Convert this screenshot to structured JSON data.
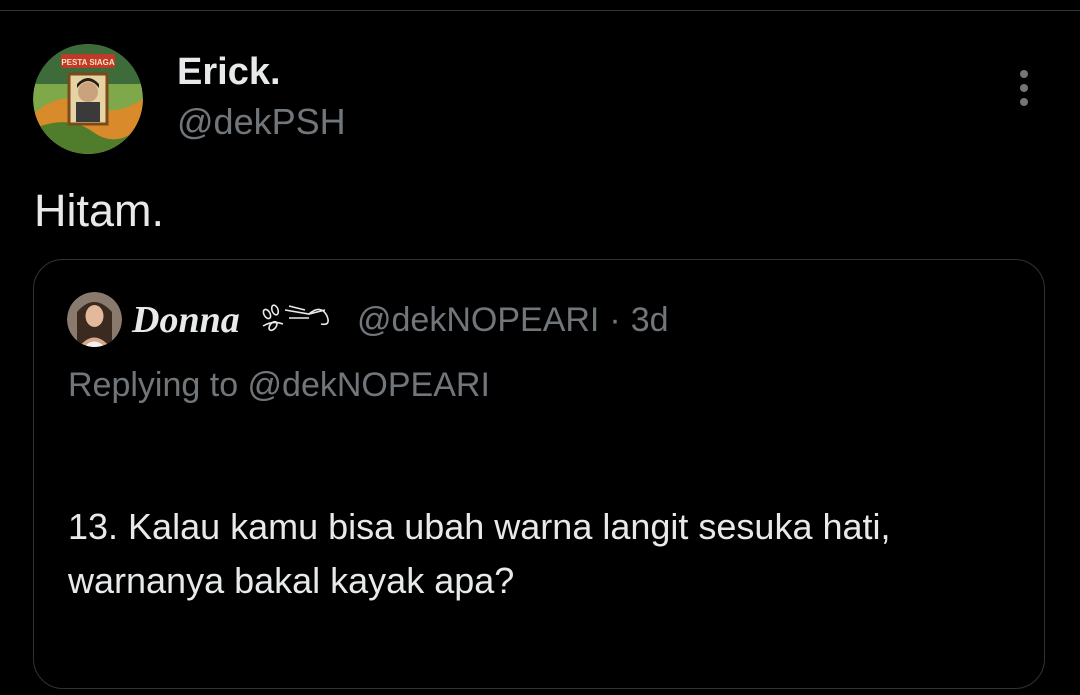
{
  "tweet": {
    "author": {
      "display_name": "Erick.",
      "handle": "@dekPSH",
      "avatar_badge_text": "PESTA SIAGA"
    },
    "text": "Hitam.",
    "more_icon": "more-vertical-icon"
  },
  "quoted_tweet": {
    "author": {
      "display_name": "Donna",
      "decoration_icon": "flower-sprig-icon",
      "handle": "@dekNOPEARI"
    },
    "separator": "·",
    "time": "3d",
    "replying_to": "Replying to @dekNOPEARI",
    "text": "13. Kalau kamu bisa ubah warna langit sesuka hati, warnanya bakal kayak apa?"
  },
  "colors": {
    "background": "#000000",
    "primary_text": "#e7e9ea",
    "secondary_text": "#71767b",
    "border": "#2f3336"
  }
}
